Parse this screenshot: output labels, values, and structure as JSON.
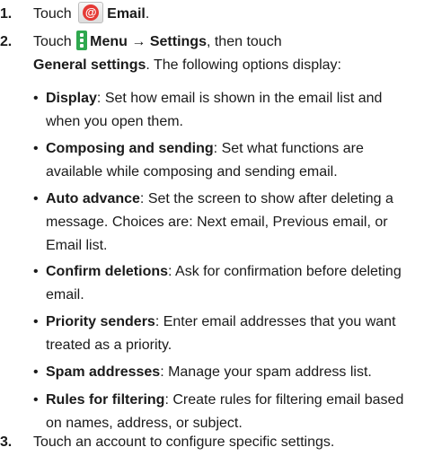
{
  "steps": [
    {
      "number": "1.",
      "pre": "Touch",
      "icon": "email-app-icon",
      "bold": "Email",
      "post": "."
    },
    {
      "number": "2.",
      "pre": "Touch",
      "icon": "menu-icon",
      "bold_menu": "Menu",
      "arrow": "→",
      "bold_settings": "Settings",
      "mid": ", then touch",
      "bold_general": "General settings",
      "post": ". The following options display:"
    },
    {
      "number": "3.",
      "text": "Touch an account to configure specific settings."
    }
  ],
  "icons": {
    "email": "@"
  },
  "bullets": [
    {
      "term": "Display",
      "desc": ": Set how email is shown in the email list and when you open them."
    },
    {
      "term": "Composing and sending",
      "desc": ": Set what functions are available while composing and sending email."
    },
    {
      "term": "Auto advance",
      "desc": ": Set the screen to show after deleting a message. Choices are: Next email, Previous email, or Email list."
    },
    {
      "term": "Confirm deletions",
      "desc": ": Ask for confirmation before deleting email."
    },
    {
      "term": "Priority senders",
      "desc": ": Enter email addresses that you want treated as a priority."
    },
    {
      "term": "Spam addresses",
      "desc": ": Manage your spam address list."
    },
    {
      "term": "Rules for filtering",
      "desc": ": Create rules for filtering email based on names, address, or subject."
    }
  ],
  "bullet_char": "•"
}
